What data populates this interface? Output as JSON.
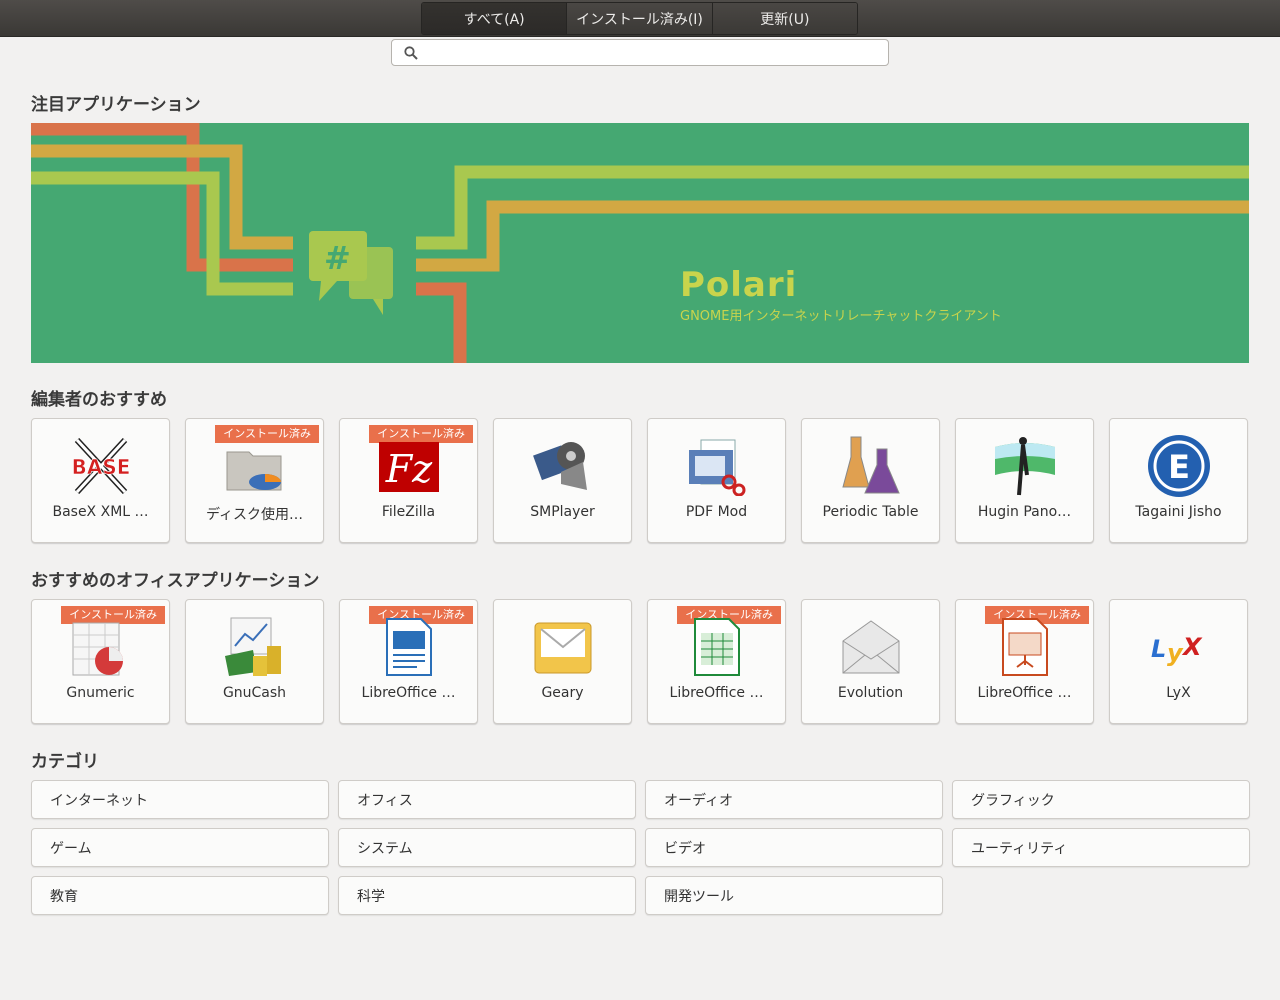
{
  "tabs": [
    {
      "label": "すべて(A)"
    },
    {
      "label": "インストール済み(I)"
    },
    {
      "label": "更新(U)"
    }
  ],
  "search": {
    "placeholder": "",
    "value": ""
  },
  "featured": {
    "title": "注目アプリケーション",
    "app_name": "Polari",
    "app_desc": "GNOME用インターネットリレーチャットクライアント",
    "colors": {
      "background": "#45a872",
      "accent": "#c9d44c"
    }
  },
  "editors_picks": {
    "title": "編集者のおすすめ",
    "apps": [
      {
        "name": "BaseX XML …",
        "badge": "",
        "icon": "basex-icon"
      },
      {
        "name": "ディスク使用…",
        "badge": "インストール済み",
        "icon": "disk-usage-icon"
      },
      {
        "name": "FileZilla",
        "badge": "インストール済み",
        "icon": "filezilla-icon"
      },
      {
        "name": "SMPlayer",
        "badge": "",
        "icon": "smplayer-icon"
      },
      {
        "name": "PDF Mod",
        "badge": "",
        "icon": "pdf-mod-icon"
      },
      {
        "name": "Periodic Table",
        "badge": "",
        "icon": "periodic-table-icon"
      },
      {
        "name": "Hugin Pano…",
        "badge": "",
        "icon": "hugin-icon"
      },
      {
        "name": "Tagaini Jisho",
        "badge": "",
        "icon": "tagaini-jisho-icon"
      }
    ]
  },
  "office": {
    "title": "おすすめのオフィスアプリケーション",
    "apps": [
      {
        "name": "Gnumeric",
        "badge": "インストール済み",
        "icon": "gnumeric-icon"
      },
      {
        "name": "GnuCash",
        "badge": "",
        "icon": "gnucash-icon"
      },
      {
        "name": "LibreOffice …",
        "badge": "インストール済み",
        "icon": "libreoffice-writer-icon"
      },
      {
        "name": "Geary",
        "badge": "",
        "icon": "geary-icon"
      },
      {
        "name": "LibreOffice …",
        "badge": "インストール済み",
        "icon": "libreoffice-calc-icon"
      },
      {
        "name": "Evolution",
        "badge": "",
        "icon": "evolution-icon"
      },
      {
        "name": "LibreOffice …",
        "badge": "インストール済み",
        "icon": "libreoffice-impress-icon"
      },
      {
        "name": "LyX",
        "badge": "",
        "icon": "lyx-icon"
      }
    ]
  },
  "categories": {
    "title": "カテゴリ",
    "items": [
      {
        "label": "インターネット"
      },
      {
        "label": "オフィス"
      },
      {
        "label": "オーディオ"
      },
      {
        "label": "グラフィック"
      },
      {
        "label": "ゲーム"
      },
      {
        "label": "システム"
      },
      {
        "label": "ビデオ"
      },
      {
        "label": "ユーティリティ"
      },
      {
        "label": "教育"
      },
      {
        "label": "科学"
      },
      {
        "label": "開発ツール"
      }
    ]
  }
}
